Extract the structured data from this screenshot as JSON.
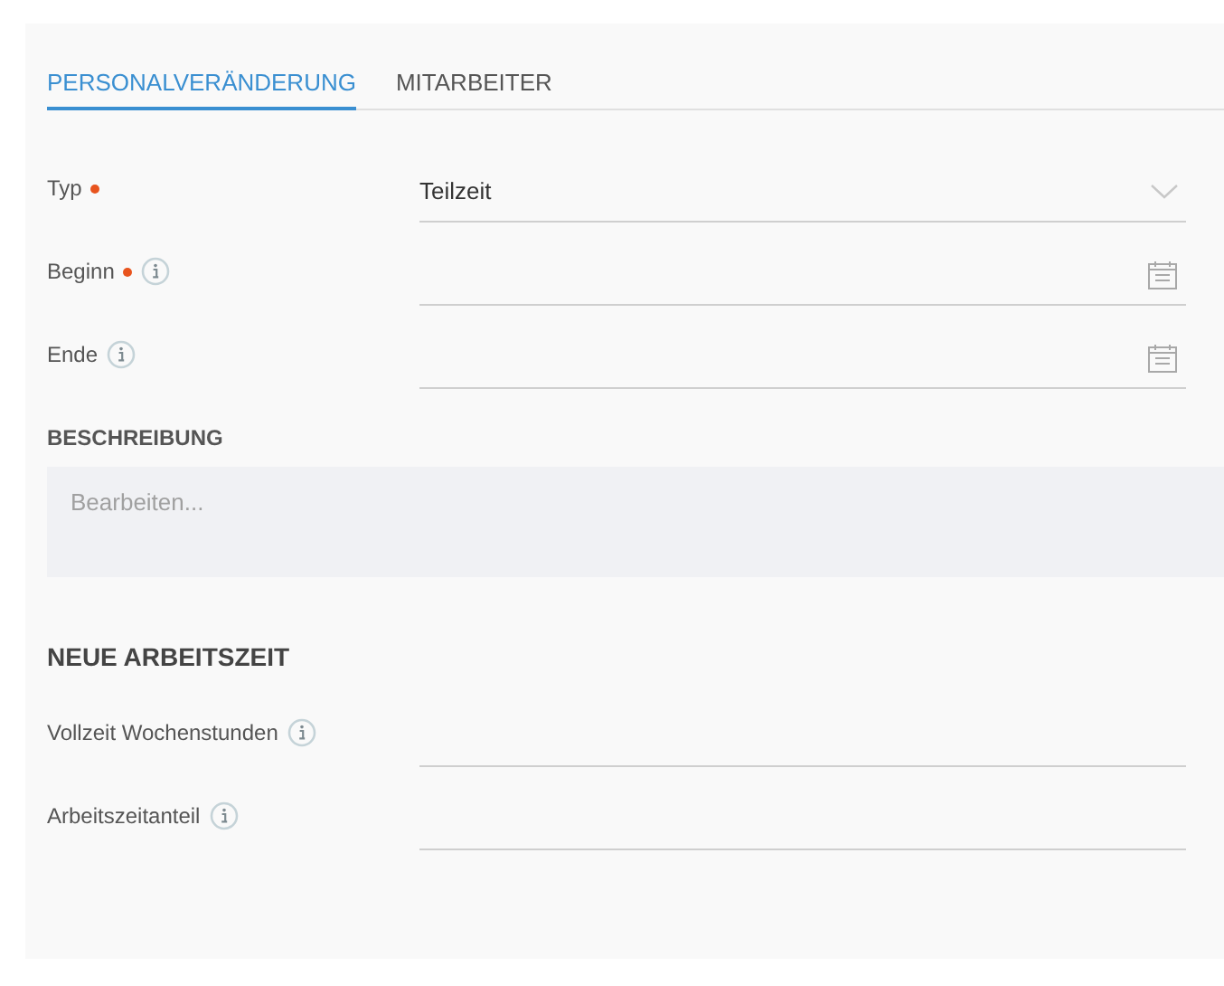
{
  "tabs": [
    {
      "label": "PERSONALVERÄNDERUNG",
      "selected": true
    },
    {
      "label": "MITARBEITER",
      "selected": false
    }
  ],
  "fields": [
    {
      "label": "Typ",
      "kind": "dropdown",
      "required": true,
      "info": false,
      "value": "Teilzeit"
    },
    {
      "label": "Beginn",
      "kind": "date",
      "required": true,
      "info": true
    },
    {
      "label": "Ende",
      "kind": "date",
      "required": false,
      "info": true
    }
  ],
  "description": {
    "heading": "BESCHREIBUNG",
    "placeholder": "Bearbeiten..."
  },
  "section": {
    "heading": "NEUE ARBEITSZEIT",
    "fields": [
      {
        "label": "Vollzeit Wochenstunden",
        "kind": "text",
        "required": false,
        "info": true
      },
      {
        "label": "Arbeitszeitanteil",
        "kind": "text",
        "required": false,
        "info": true
      }
    ]
  }
}
